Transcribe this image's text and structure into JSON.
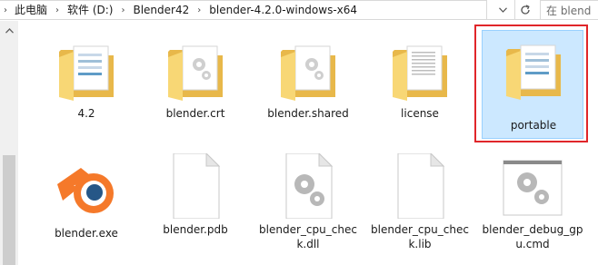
{
  "address_bar": {
    "breadcrumbs": [
      "此电脑",
      "软件 (D:)",
      "Blender42",
      "blender-4.2.0-windows-x64"
    ],
    "search_placeholder": "在 blend"
  },
  "items": [
    {
      "label": "4.2",
      "type": "folder",
      "icon": "folder-icon"
    },
    {
      "label": "blender.crt",
      "type": "folder",
      "icon": "folder-icon"
    },
    {
      "label": "blender.shared",
      "type": "folder",
      "icon": "folder-icon"
    },
    {
      "label": "license",
      "type": "folder",
      "icon": "folder-icon"
    },
    {
      "label": "portable",
      "type": "folder",
      "icon": "folder-icon",
      "selected": true
    },
    {
      "label": "blender.exe",
      "type": "exe",
      "icon": "blender-logo-icon"
    },
    {
      "label": "blender.pdb",
      "type": "file",
      "icon": "file-icon"
    },
    {
      "label": "blender_cpu_check.dll",
      "type": "dll",
      "icon": "gear-file-icon"
    },
    {
      "label": "blender_cpu_check.lib",
      "type": "file",
      "icon": "file-icon"
    },
    {
      "label": "blender_debug_gpu.cmd",
      "type": "cmd",
      "icon": "gear-window-icon"
    }
  ],
  "colors": {
    "selection_bg": "#cce8ff",
    "highlight_border": "#e0262a",
    "folder_yellow": "#f8d775",
    "blender_orange": "#f5792a",
    "blender_blue": "#265787"
  }
}
